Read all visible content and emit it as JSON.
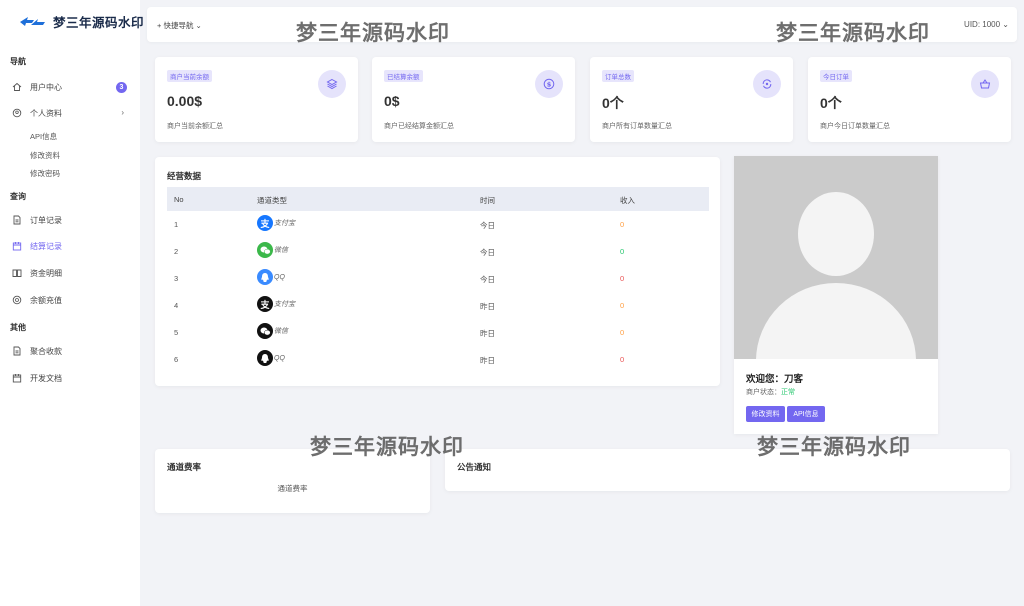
{
  "brand": {
    "logo_text": "梦三年源码水印"
  },
  "sidebar": {
    "sections": [
      "导航",
      "查询",
      "其他"
    ],
    "items": [
      {
        "label": "用户中心",
        "badge": "3"
      },
      {
        "label": "个人资料"
      },
      {
        "label": "订单记录"
      },
      {
        "label": "结算记录"
      },
      {
        "label": "资金明细"
      },
      {
        "label": "余额充值"
      },
      {
        "label": "聚合收款"
      },
      {
        "label": "开发文档"
      }
    ],
    "sub_items": [
      "API信息",
      "修改资料",
      "修改密码"
    ]
  },
  "topbar": {
    "quick_nav": "+ 快捷导航 ⌄",
    "uid": "UID: 1000 ⌄"
  },
  "watermark": "梦三年源码水印",
  "stats": [
    {
      "tag": "商户当前余额",
      "value": "0.00$",
      "desc": "商户当前余额汇总",
      "icon": "layers-icon"
    },
    {
      "tag": "已结算余额",
      "value": "0$",
      "desc": "商户已经结算金额汇总",
      "icon": "dollar-icon"
    },
    {
      "tag": "订单总数",
      "value": "0个",
      "desc": "商户所有订单数量汇总",
      "icon": "refresh-icon"
    },
    {
      "tag": "今日订单",
      "value": "0个",
      "desc": "商户今日订单数量汇总",
      "icon": "basket-icon"
    }
  ],
  "table": {
    "title": "经营数据",
    "headers": [
      "No",
      "通道类型",
      "时间",
      "收入"
    ],
    "rows": [
      {
        "no": "1",
        "channel": "支付宝",
        "time": "今日",
        "income": "0",
        "icon": "alipay-icon",
        "income_color": "#ff9f43"
      },
      {
        "no": "2",
        "channel": "微信",
        "time": "今日",
        "income": "0",
        "icon": "wechat-icon",
        "income_color": "#28c76f"
      },
      {
        "no": "3",
        "channel": "QQ",
        "time": "今日",
        "income": "0",
        "icon": "qq-icon",
        "income_color": "#ea5455"
      },
      {
        "no": "4",
        "channel": "支付宝",
        "time": "昨日",
        "income": "0",
        "icon": "alipay-icon",
        "income_color": "#ff9f43"
      },
      {
        "no": "5",
        "channel": "微信",
        "time": "昨日",
        "income": "0",
        "icon": "wechat-icon",
        "income_color": "#ff9f43"
      },
      {
        "no": "6",
        "channel": "QQ",
        "time": "昨日",
        "income": "0",
        "icon": "qq-icon",
        "income_color": "#ea5455"
      }
    ]
  },
  "profile": {
    "welcome": "欢迎您：刀客",
    "status_label": "商户状态：",
    "status_value": "正常",
    "btn_edit": "修改资料",
    "btn_api": "API信息"
  },
  "rates": {
    "title": "通道费率",
    "body": "通道费率"
  },
  "notice": {
    "title": "公告通知"
  },
  "colors": {
    "accent": "#7367f0",
    "success": "#28c76f",
    "warning": "#ff9f43",
    "danger": "#ea5455"
  }
}
